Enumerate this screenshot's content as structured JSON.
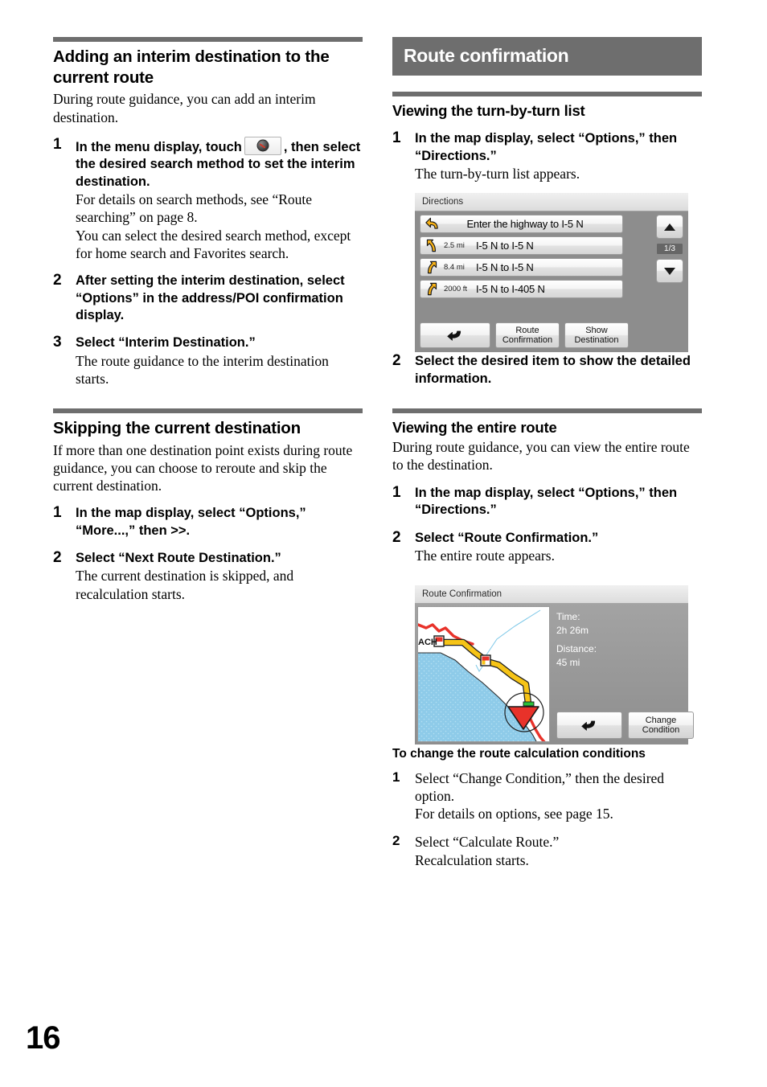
{
  "page": {
    "number": "16"
  },
  "left_column": {
    "section1": {
      "heading": "Adding an interim destination to the current route",
      "intro": "During route guidance, you can add an interim destination.",
      "steps": [
        {
          "num": "1",
          "lead_a": "In the menu display, touch",
          "icon": "compass-icon",
          "lead_b": ", then select the desired search method to set the interim destination.",
          "sub": "For details on search methods, see “Route searching” on page 8.",
          "sub2": "You can select the desired search method, except for home search and Favorites search."
        },
        {
          "num": "2",
          "lead": "After setting the interim destination, select “Options” in the address/POI confirmation display.",
          "sub": ""
        },
        {
          "num": "3",
          "lead": "Select “Interim Destination.”",
          "sub": "The route guidance to the interim destination starts."
        }
      ]
    },
    "section2": {
      "heading": "Skipping the current destination",
      "intro": "If more than one destination point exists during route guidance, you can choose to reroute and skip the current destination.",
      "steps": [
        {
          "num": "1",
          "lead": "In the map display, select “Options,” “More...,” then >>.",
          "sub": ""
        },
        {
          "num": "2",
          "lead": "Select “Next Route Destination.”",
          "sub": "The current destination is skipped, and recalculation starts."
        }
      ]
    }
  },
  "right_column": {
    "banner": "Route confirmation",
    "section1": {
      "heading": "Viewing the turn-by-turn list",
      "steps": [
        {
          "num": "1",
          "lead": "In the map display, select “Options,” then “Directions.”",
          "sub": "The turn-by-turn list appears."
        },
        {
          "num": "2",
          "lead": "Select the desired item to show the detailed information.",
          "sub": ""
        }
      ]
    },
    "section2": {
      "heading": "Viewing the entire route",
      "intro": "During route guidance, you can view the entire route to the destination.",
      "steps": [
        {
          "num": "1",
          "lead": "In the map display, select “Options,” then “Directions.”",
          "sub": ""
        },
        {
          "num": "2",
          "lead": "Select “Route Confirmation.”",
          "sub": "The entire route appears."
        }
      ]
    },
    "section3": {
      "heading": "To change the route calculation conditions",
      "steps": [
        {
          "num": "1",
          "lead": "Select “Change Condition,” then the desired option.",
          "sub": "For details on options, see page 15."
        },
        {
          "num": "2",
          "lead": "Select “Calculate Route.”",
          "sub": "Recalculation starts."
        }
      ]
    }
  },
  "directions_screenshot": {
    "title": "Directions",
    "rows": [
      {
        "icon": "turn-left-arrow-icon",
        "distance": "",
        "label": "Enter the highway to I-5 N"
      },
      {
        "icon": "turn-slight-left-arrow-icon",
        "distance": "2.5 mi",
        "label": "I-5 N to I-5 N"
      },
      {
        "icon": "turn-slight-right-arrow-icon",
        "distance": "8.4 mi",
        "label": "I-5 N to I-5 N"
      },
      {
        "icon": "turn-slight-right-arrow-icon",
        "distance": "2000 ft",
        "label": "I-5 N to I-405 N"
      }
    ],
    "page_indicator": "1/3",
    "scroll_up": "scroll-up-icon",
    "scroll_down": "scroll-down-icon",
    "buttons": {
      "back": "back-arrow-icon",
      "route_confirmation": "Route\nConfirmation",
      "route_confirmation_line1": "Route",
      "route_confirmation_line2": "Confirmation",
      "show_destination_line1": "Show",
      "show_destination_line2": "Destination"
    }
  },
  "route_confirmation_screenshot": {
    "title": "Route Confirmation",
    "info": {
      "time_label": "Time:",
      "time_value": "2h 26m",
      "distance_label": "Distance:",
      "distance_value": "45 mi"
    },
    "map_label": "ACH",
    "buttons": {
      "back": "back-arrow-icon",
      "change_condition_line1": "Change",
      "change_condition_line2": "Condition"
    }
  },
  "colors": {
    "banner_gray": "#6e6e6e",
    "rule_gray": "#6e6e6e",
    "route_yellow": "#f5c21a",
    "road_red": "#e8332a",
    "water_blue": "#8cc8e8",
    "arrow_orange": "#f7a81b"
  }
}
